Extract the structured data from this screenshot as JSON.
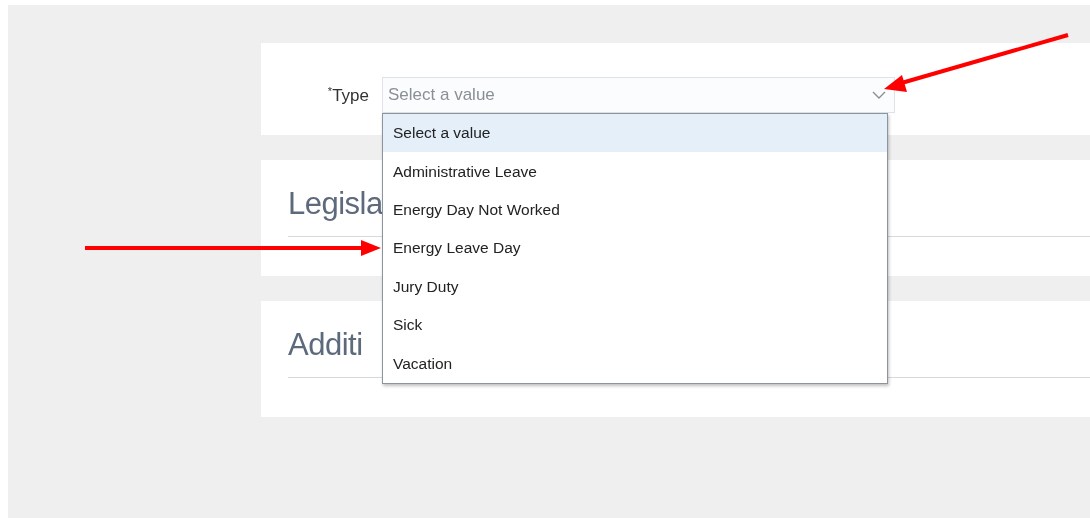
{
  "form": {
    "label": "$^{*}$Type",
    "placeholder": "Select a value",
    "expanded": true
  },
  "options": [
    {
      "label": "Select a value",
      "selected": true
    },
    {
      "label": "Administrative Leave",
      "selected": false
    },
    {
      "label": "Energy Day Not Worked",
      "selected": false
    },
    {
      "label": "Energy Leave Day",
      "selected": false
    },
    {
      "label": "Jury Duty",
      "selected": false
    },
    {
      "label": "Sick",
      "selected": false
    },
    {
      "label": "Vacation",
      "selected": false
    }
  ],
  "sections": [
    {
      "title": "Legisla"
    },
    {
      "title": "Additi"
    }
  ]
}
